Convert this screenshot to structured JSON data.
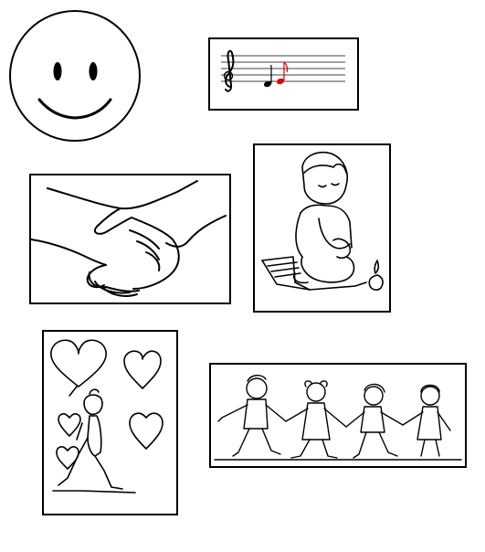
{
  "pictures": [
    {
      "icon": "smiley-face-icon"
    },
    {
      "icon": "music-staff-icon",
      "colors": {
        "note_1": "#000000",
        "note_2": "#e00000"
      }
    },
    {
      "icon": "handshake-icon"
    },
    {
      "icon": "praying-child-icon"
    },
    {
      "icon": "child-with-hearts-icon"
    },
    {
      "icon": "children-holding-hands-icon"
    }
  ]
}
